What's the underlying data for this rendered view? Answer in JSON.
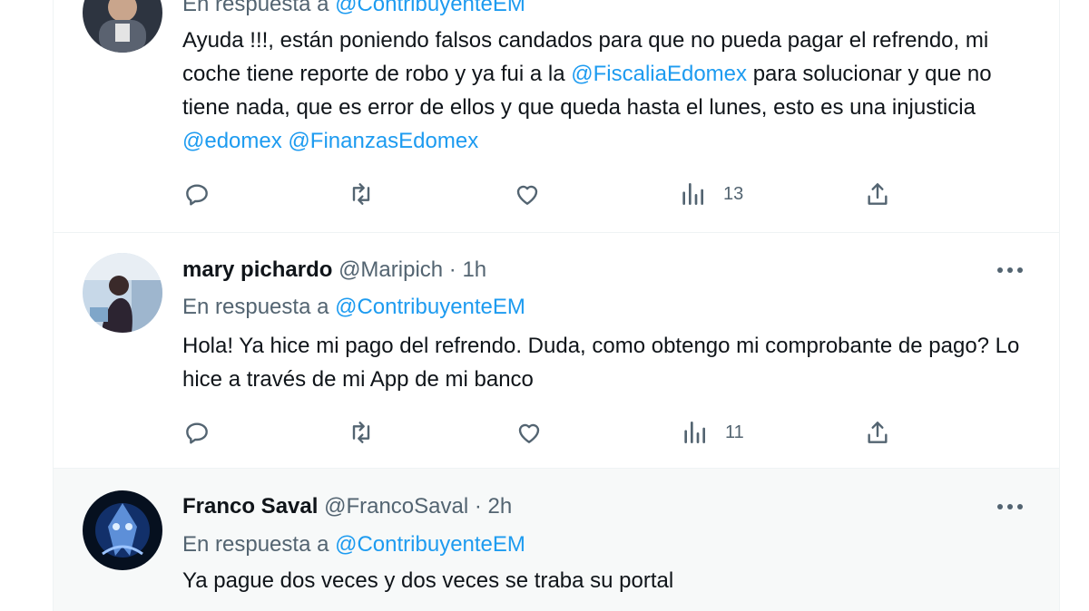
{
  "tweets": [
    {
      "reply_prefix": "En respuesta a",
      "reply_to": "@ContribuyenteEM",
      "text_parts": {
        "t1": "Ayuda !!!, están poniendo falsos candados para que no pueda pagar el refrendo, mi coche tiene reporte de robo y ya fui a la ",
        "m1": "@FiscaliaEdomex",
        "t2": " para solucionar y que no tiene nada, que es error de ellos y que queda hasta el lunes, esto es una injusticia ",
        "m2": "@edomex",
        "t3": " ",
        "m3": "@FinanzasEdomex"
      },
      "views": "13"
    },
    {
      "name": "mary pichardo",
      "handle": "@Maripich",
      "sep": " · ",
      "time": "1h",
      "reply_prefix": "En respuesta a",
      "reply_to": "@ContribuyenteEM",
      "text": "Hola! Ya hice mi pago del refrendo. Duda, como obtengo mi comprobante de pago? Lo hice a través de mi App de mi banco",
      "views": "11"
    },
    {
      "name": "Franco Saval",
      "handle": "@FrancoSaval",
      "sep": " · ",
      "time": "2h",
      "reply_prefix": "En respuesta a",
      "reply_to": "@ContribuyenteEM",
      "text": "Ya pague dos veces y dos veces se traba su portal"
    }
  ],
  "icons": {
    "reply": "comment-bubble-icon",
    "retweet": "retweet-arrows-icon",
    "like": "heart-icon",
    "views": "bar-chart-icon",
    "share": "share-upload-icon",
    "more": "three-dots-icon"
  },
  "colors": {
    "link": "#1d9bf0",
    "secondary_text": "#536471",
    "primary_text": "#0f1419",
    "hover_background": "#f7f9f9"
  }
}
